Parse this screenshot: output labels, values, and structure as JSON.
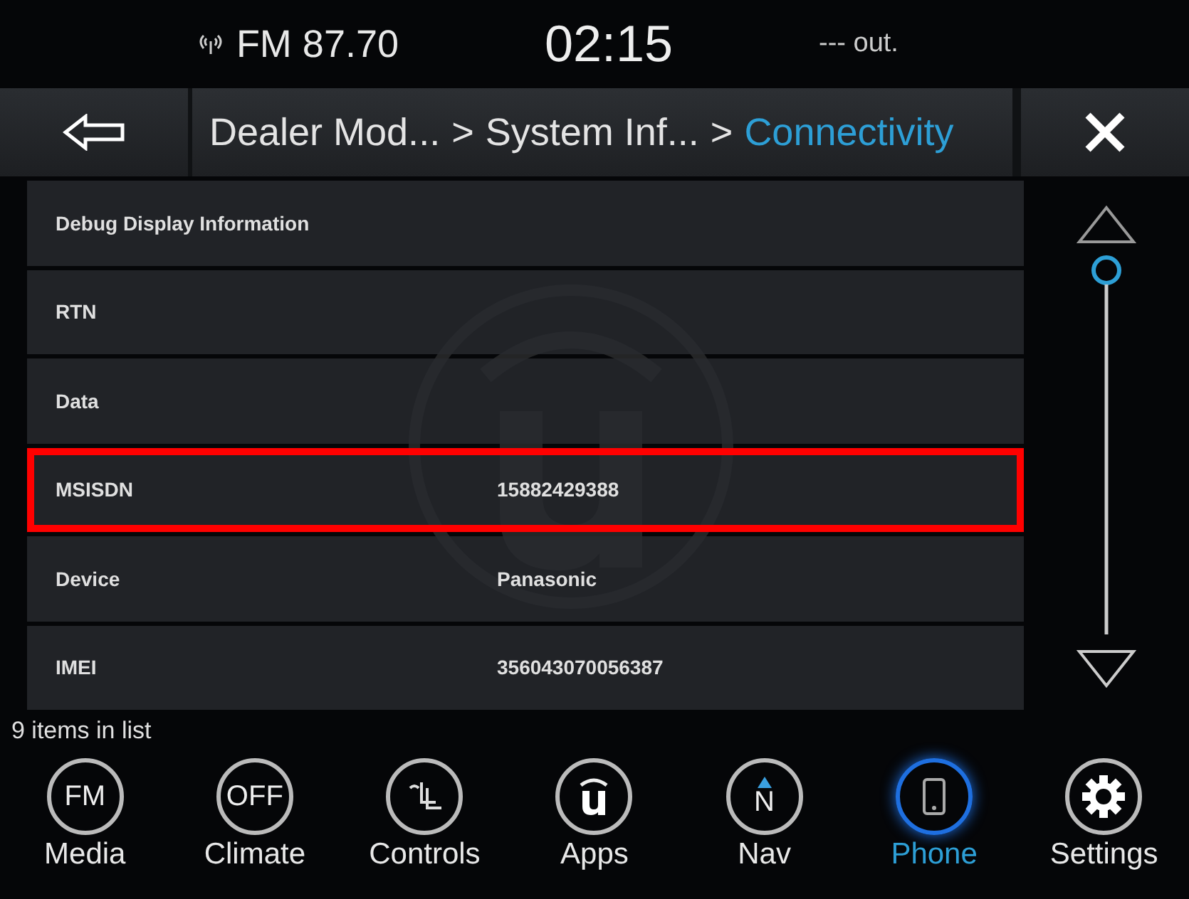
{
  "status_bar": {
    "source": "FM 87.70",
    "time": "02:15",
    "temperature": "--- out."
  },
  "header": {
    "breadcrumb": [
      {
        "text": "Dealer Mod...",
        "current": false
      },
      {
        "text": "System Inf...",
        "current": false
      },
      {
        "text": "Connectivity",
        "current": true
      }
    ],
    "separator": ">"
  },
  "rows": [
    {
      "label": "Debug Display Information",
      "highlighted": false
    },
    {
      "label": "RTN",
      "highlighted": false
    },
    {
      "label": "Data",
      "highlighted": false
    },
    {
      "label": "MSISDN",
      "value": "15882429388",
      "highlighted": true
    },
    {
      "label": "Device",
      "value": "Panasonic",
      "highlighted": false
    },
    {
      "label": "IMEI",
      "value": "356043070056387",
      "highlighted": false
    }
  ],
  "list_count": "9 items in list",
  "nav": [
    {
      "kind": "badge",
      "icon_text": "FM",
      "label": "Media",
      "selected": false
    },
    {
      "kind": "badge",
      "icon_text": "OFF",
      "label": "Climate",
      "selected": false
    },
    {
      "kind": "seat",
      "label": "Controls",
      "selected": false
    },
    {
      "kind": "apps",
      "label": "Apps",
      "selected": false
    },
    {
      "kind": "compass",
      "icon_text": "N",
      "label": "Nav",
      "selected": false
    },
    {
      "kind": "phone",
      "label": "Phone",
      "selected": true
    },
    {
      "kind": "gear",
      "label": "Settings",
      "selected": false
    }
  ]
}
